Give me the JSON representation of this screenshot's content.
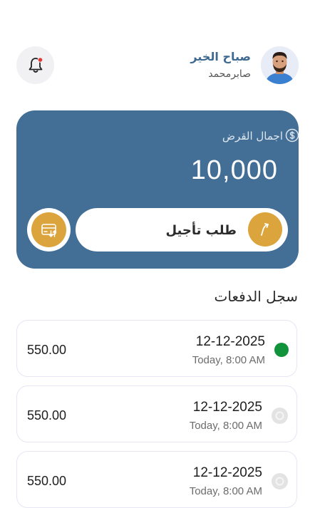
{
  "header": {
    "greeting": "صباح الخير",
    "username": "صابرمحمد",
    "bell_has_notification": true
  },
  "loan": {
    "label": "اجمال القرض",
    "amount": "10,000",
    "defer_label": "طلب تأجيل",
    "card_color": "#436e95",
    "accent_color": "#dba43c"
  },
  "payments": {
    "title": "سجل الدفعات",
    "items": [
      {
        "amount": "550.00",
        "date": "12-12-2025",
        "time": "Today, 8:00 AM",
        "status": "paid"
      },
      {
        "amount": "550.00",
        "date": "12-12-2025",
        "time": "Today, 8:00 AM",
        "status": "pending"
      },
      {
        "amount": "550.00",
        "date": "12-12-2025",
        "time": "Today, 8:00 AM",
        "status": "pending"
      }
    ]
  }
}
